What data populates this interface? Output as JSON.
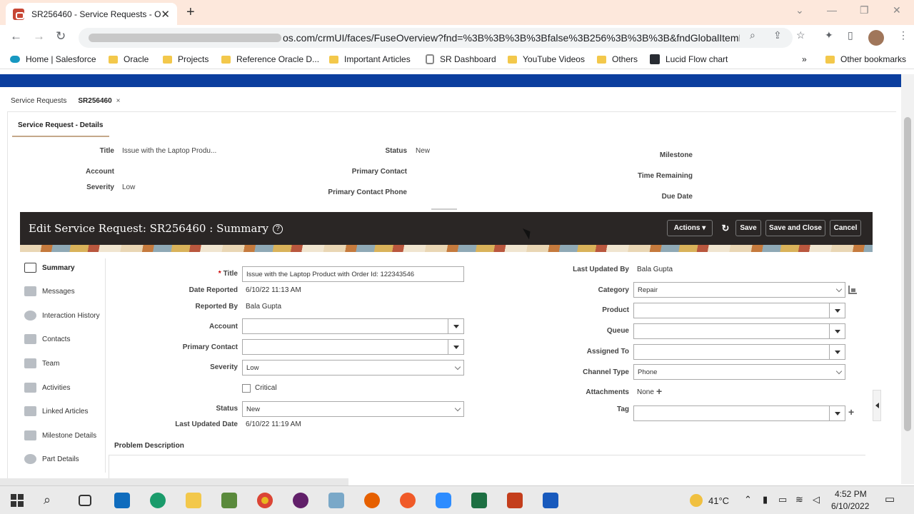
{
  "browser": {
    "tab_title": "SR256460 - Service Requests - O",
    "url_suffix": "os.com/crmUI/faces/FuseOverview?fnd=%3B%3B%3B%3Bfalse%3B256%3B%3B%3B&fndGlobalItemNod...",
    "bookmarks": [
      "Home | Salesforce",
      "Oracle",
      "Projects",
      "Reference Oracle D...",
      "Important Articles",
      "SR Dashboard",
      "YouTube Videos",
      "Others",
      "Lucid Flow chart"
    ],
    "more_bookmarks": "»",
    "other_bookmarks": "Other bookmarks"
  },
  "page_tabs": {
    "tab1": "Service Requests",
    "tab2": "SR256460",
    "close": "×"
  },
  "subtab": "Service Request - Details",
  "header": {
    "title_label": "Title",
    "title_value": "Issue with the Laptop Produ...",
    "account_label": "Account",
    "severity_label": "Severity",
    "severity_value": "Low",
    "status_label": "Status",
    "status_value": "New",
    "primary_contact_label": "Primary Contact",
    "primary_contact_phone_label": "Primary Contact Phone",
    "milestone_label": "Milestone",
    "time_remaining_label": "Time Remaining",
    "due_date_label": "Due Date"
  },
  "edit": {
    "title": "Edit Service Request: SR256460 : Summary",
    "help": "?",
    "actions": "Actions",
    "refresh": "↻",
    "save": "Save",
    "save_close": "Save and Close",
    "cancel": "Cancel"
  },
  "leftnav": [
    "Summary",
    "Messages",
    "Interaction History",
    "Contacts",
    "Team",
    "Activities",
    "Linked Articles",
    "Milestone Details",
    "Part Details"
  ],
  "form": {
    "required_mark": "*",
    "title_label": "Title",
    "title_value": "Issue with the Laptop Product with Order Id: 122343546",
    "date_reported_label": "Date Reported",
    "date_reported_value": "6/10/22 11:13 AM",
    "reported_by_label": "Reported By",
    "reported_by_value": "Bala Gupta",
    "account_label": "Account",
    "primary_contact_label": "Primary Contact",
    "severity_label": "Severity",
    "severity_value": "Low",
    "critical_label": "Critical",
    "status_label": "Status",
    "status_value": "New",
    "last_updated_date_label": "Last Updated Date",
    "last_updated_date_value": "6/10/22 11:19 AM",
    "problem_description_label": "Problem Description",
    "last_updated_by_label": "Last Updated By",
    "last_updated_by_value": "Bala Gupta",
    "category_label": "Category",
    "category_value": "Repair",
    "product_label": "Product",
    "queue_label": "Queue",
    "assigned_to_label": "Assigned To",
    "channel_type_label": "Channel Type",
    "channel_type_value": "Phone",
    "attachments_label": "Attachments",
    "attachments_value": "None",
    "tag_label": "Tag",
    "plus": "+"
  },
  "taskbar": {
    "temperature": "41°C",
    "time": "4:52 PM",
    "date": "6/10/2022"
  },
  "colors": {
    "brand_blue": "#0b3e9e",
    "edit_bar": "#2a2625",
    "oracle_red": "#c74634"
  }
}
